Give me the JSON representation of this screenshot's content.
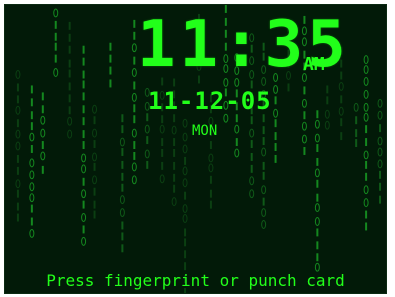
{
  "clock": {
    "time": "11:35",
    "ampm": "AM",
    "date": "11-12-05",
    "day": "MON"
  },
  "prompt": {
    "text": "Press fingerprint or punch card"
  },
  "colors": {
    "screen_bg": "#021a08",
    "primary_text": "#22ff1a",
    "rain_dim": "#0b3f12",
    "rain_mid": "#0f5a18",
    "rain_bright": "#14881f"
  }
}
